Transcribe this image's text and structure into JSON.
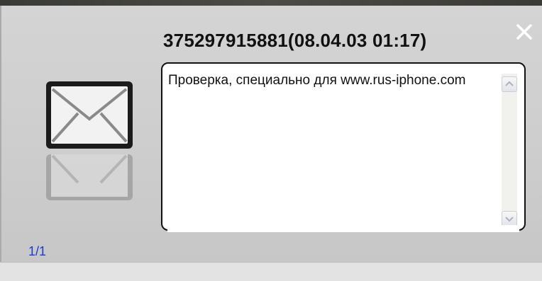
{
  "notification": {
    "title": "375297915881(08.04.03 01:17)",
    "message": "Проверка, специально для www.rus-iphone.com",
    "counter": "1/1"
  },
  "icons": {
    "close": "close-icon",
    "envelope": "envelope-icon",
    "scroll_up": "chevron-up-icon",
    "scroll_down": "chevron-down-icon"
  },
  "colors": {
    "counter": "#1a3ad6",
    "panel": "#d0d0d0"
  }
}
